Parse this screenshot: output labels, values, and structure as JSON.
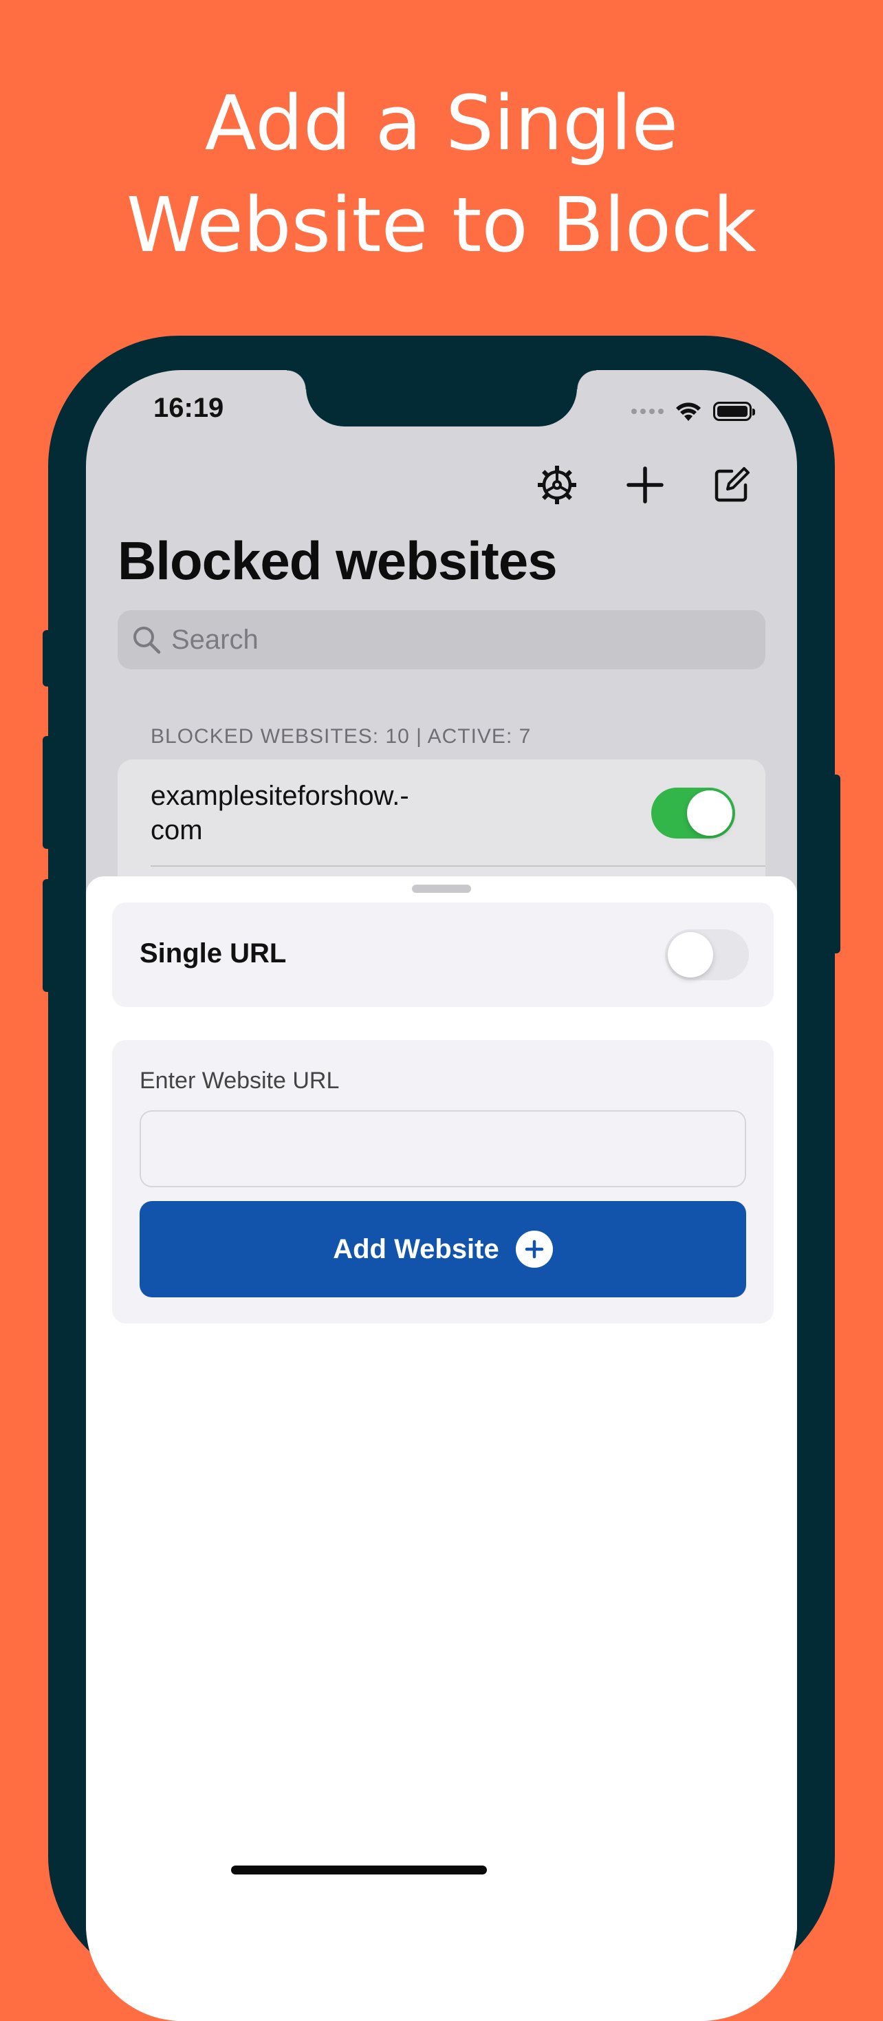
{
  "marketing": {
    "headline_line1": "Add a Single",
    "headline_line2": "Website to Block",
    "background_color": "#FF6E42"
  },
  "status_bar": {
    "time": "16:19"
  },
  "toolbar": {
    "icons": [
      "gear-icon",
      "plus-icon",
      "compose-icon"
    ]
  },
  "main": {
    "title": "Blocked websites",
    "search_placeholder": "Search",
    "section_header": "BLOCKED WEBSITES: 10 | ACTIVE: 7",
    "rows": [
      {
        "domain": "examplesiteforshow.-\ncom",
        "enabled": true
      }
    ]
  },
  "sheet": {
    "single_url_label": "Single URL",
    "single_url_enabled": false,
    "field_label": "Enter Website URL",
    "url_value": "",
    "add_button_label": "Add Website",
    "accent_color": "#1254AC",
    "toggle_on_color": "#32B549"
  }
}
